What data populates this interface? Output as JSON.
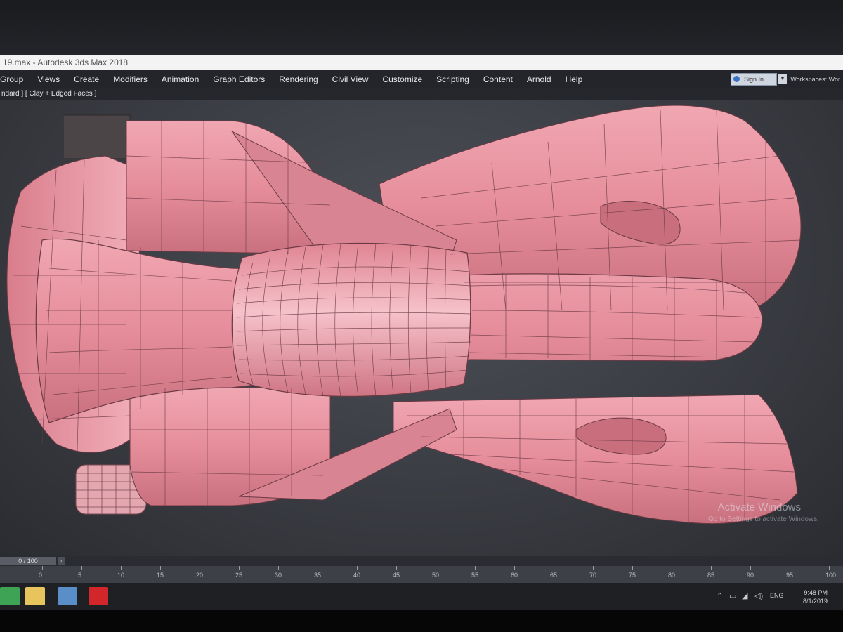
{
  "window": {
    "title": "19.max - Autodesk 3ds Max 2018"
  },
  "menubar": {
    "items": [
      "Group",
      "Views",
      "Create",
      "Modifiers",
      "Animation",
      "Graph Editors",
      "Rendering",
      "Civil View",
      "Customize",
      "Scripting",
      "Content",
      "Arnold",
      "Help"
    ]
  },
  "account": {
    "signin_label": "Sign In",
    "workspaces_label": "Workspaces: Wor"
  },
  "viewport": {
    "label": "ndard ] [ Clay + Edged Faces ]",
    "model_color": "#e08d9a",
    "wire_color": "#6b3a44",
    "background": "#35373d"
  },
  "watermark": {
    "title": "Activate Windows",
    "subtitle": "Go to Settings to activate Windows."
  },
  "timeline": {
    "slider_label": "0 / 100",
    "ruler_ticks": [
      "0",
      "5",
      "10",
      "15",
      "20",
      "25",
      "30",
      "35",
      "40",
      "45",
      "50",
      "55",
      "60",
      "65",
      "70",
      "75",
      "80",
      "85",
      "90",
      "95",
      "100"
    ]
  },
  "taskbar": {
    "apps": [
      {
        "name": "app-green",
        "color": "#3ea355"
      },
      {
        "name": "file-explorer",
        "color": "#e8c45c"
      },
      {
        "name": "photos",
        "color": "#5a8ec9"
      },
      {
        "name": "pdf-reader",
        "color": "#d3262b"
      }
    ],
    "language": "ENG",
    "time": "9:48 PM",
    "date": "8/1/2019"
  }
}
